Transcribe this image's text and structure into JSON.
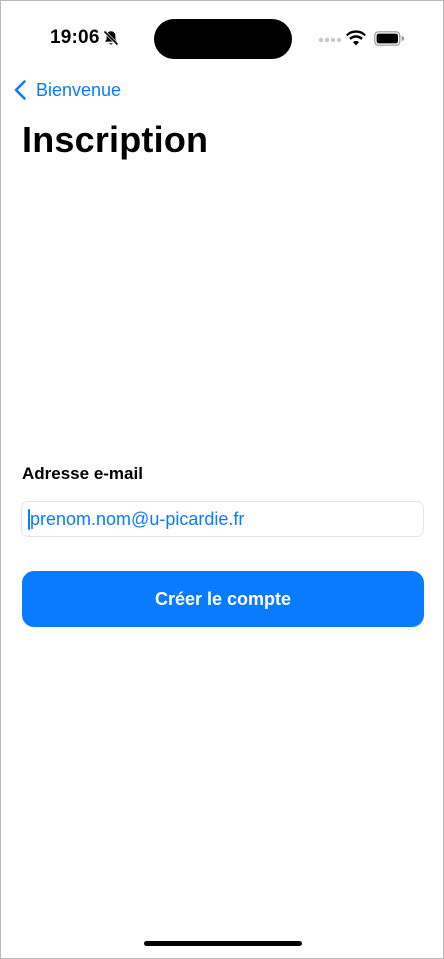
{
  "status_bar": {
    "time": "19:06",
    "icons": [
      "bell-slash-icon",
      "signal-icon",
      "wifi-icon",
      "battery-icon"
    ]
  },
  "nav": {
    "back_label": "Bienvenue",
    "back_icon": "chevron-left-icon"
  },
  "page": {
    "title": "Inscription"
  },
  "form": {
    "email_label": "Adresse e-mail",
    "email_value": "",
    "email_placeholder": "prenom.nom@u-picardie.fr",
    "submit_label": "Créer le compte"
  },
  "colors": {
    "accent": "#0a7aff",
    "background": "#ffffff",
    "text": "#000000"
  }
}
